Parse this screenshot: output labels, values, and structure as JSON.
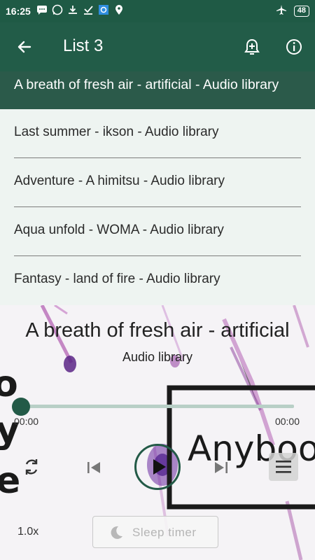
{
  "status_bar": {
    "time": "16:25",
    "battery": "48"
  },
  "app_bar": {
    "title": "List 3"
  },
  "playlist": {
    "items": [
      {
        "label": "A breath of fresh air - artificial - Audio library"
      },
      {
        "label": "Last summer - ikson - Audio library"
      },
      {
        "label": "Adventure - A himitsu - Audio library"
      },
      {
        "label": "Aqua unfold - WOMA - Audio library"
      },
      {
        "label": "Fantasy - land of fire - Audio library"
      }
    ]
  },
  "player": {
    "title": "A breath of fresh air - artificial",
    "artist": "Audio library",
    "current_time": "00:00",
    "total_time": "00:00",
    "progress": 0,
    "speed": "1.0x",
    "sleep_timer_label": "Sleep timer",
    "background_text": "Anyboo",
    "accent_color": "#235a47"
  }
}
